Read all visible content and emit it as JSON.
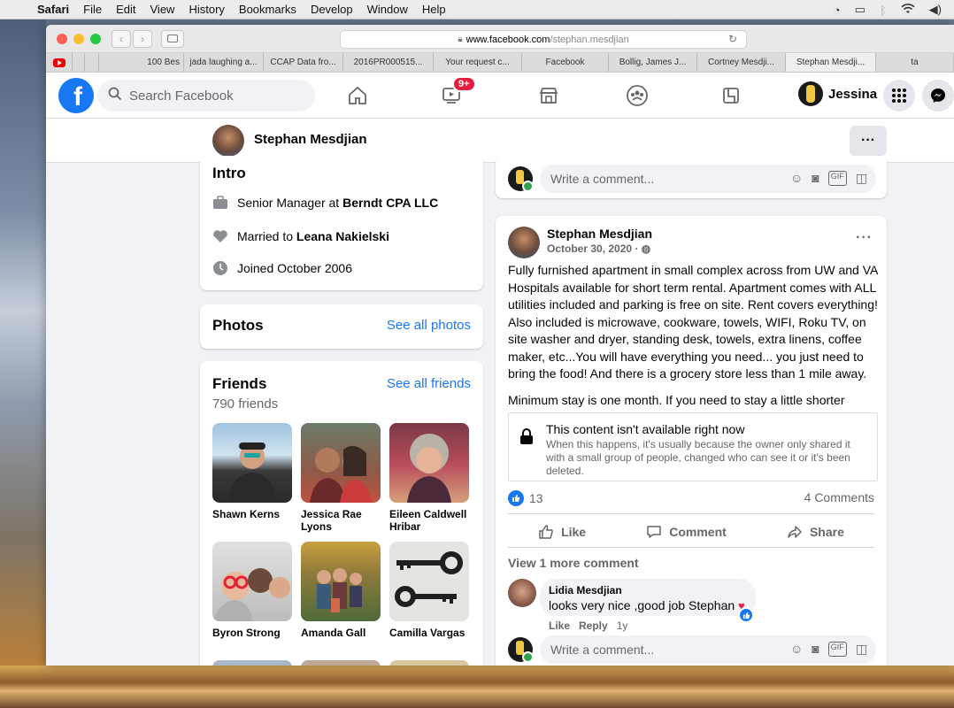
{
  "menubar": {
    "items": [
      "Safari",
      "File",
      "Edit",
      "View",
      "History",
      "Bookmarks",
      "Develop",
      "Window",
      "Help"
    ]
  },
  "browser": {
    "url_host": "www.facebook.com",
    "url_path": "/stephan.mesdjian",
    "tabs": [
      "",
      "",
      "100 Bes",
      "jada laughing a...",
      "CCAP Data fro...",
      "2016PR000515...",
      "Your request c...",
      "Facebook",
      "Bollig, James J...",
      "Cortney Mesdji...",
      "Stephan Mesdji...",
      "ta"
    ]
  },
  "fbnav": {
    "search_placeholder": "Search Facebook",
    "watch_badge": "9+",
    "user_name": "Jessina",
    "logo": "f"
  },
  "profile": {
    "name": "Stephan Mesdjian",
    "more": "···"
  },
  "intro": {
    "title": "Intro",
    "work_prefix": "Senior Manager at ",
    "work_place": "Berndt CPA LLC",
    "relationship_prefix": "Married to ",
    "relationship_name": "Leana Nakielski",
    "joined": "Joined October 2006"
  },
  "photos": {
    "title": "Photos",
    "link": "See all photos"
  },
  "friends": {
    "title": "Friends",
    "link": "See all friends",
    "count": "790 friends",
    "list": [
      {
        "name": "Shawn Kerns"
      },
      {
        "name": "Jessica Rae Lyons"
      },
      {
        "name": "Eileen Caldwell Hribar"
      },
      {
        "name": "Byron Strong"
      },
      {
        "name": "Amanda Gall"
      },
      {
        "name": "Camilla Vargas"
      }
    ]
  },
  "comment_box": {
    "placeholder": "Write a comment..."
  },
  "post": {
    "author": "Stephan Mesdjian",
    "date": "October 30, 2020 · ",
    "dots": "···",
    "paragraph1": "Fully furnished apartment in small complex across from UW and VA Hospitals available for short term rental.  Apartment comes with ALL utilities included and parking is free on site.  Rent covers everything!  Also included is microwave, cookware, towels, WIFI, Roku TV, on site washer and dryer, standing desk, towels, extra linens, coffee maker, etc...You will have everything you need... you just need to bring the food!  And there is a grocery store less than 1 mile away.",
    "paragraph2": "Minimum stay is one month.  If you need to stay a little shorter contact me and we will see if we can work it out.",
    "unavailable_title": "This content isn't available right now",
    "unavailable_desc": "When this happens, it's usually because the owner only shared it with a small group of people, changed who can see it or it's been deleted.",
    "reaction_count": "13",
    "comment_count": "4 Comments",
    "like_label": "Like",
    "comment_label": "Comment",
    "share_label": "Share",
    "view_more": "View 1 more comment",
    "comment": {
      "name": "Lidia Mesdjian",
      "text": "looks very nice ,good job Stephan",
      "like": "Like",
      "reply": "Reply",
      "age": "1y"
    }
  }
}
